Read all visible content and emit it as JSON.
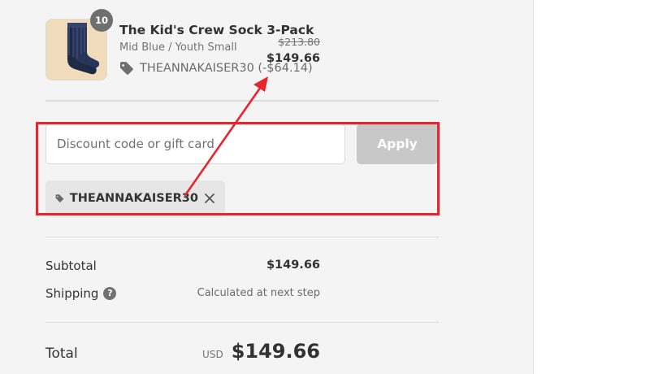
{
  "product": {
    "quantity_badge": "10",
    "name": "The Kid's Crew Sock 3-Pack",
    "variant": "Mid Blue / Youth Small",
    "discount_line": "THEANNAKAISER30 (-$64.14)",
    "original_price": "$213.80",
    "price": "$149.66",
    "image_icon": "sock-product-image"
  },
  "discount": {
    "placeholder": "Discount code or gift card",
    "value": "",
    "apply_label": "Apply",
    "applied_code": "THEANNAKAISER30",
    "tag_icon": "tag-icon",
    "remove_icon": "close-icon"
  },
  "summary": {
    "subtotal_label": "Subtotal",
    "subtotal_value": "$149.66",
    "shipping_label": "Shipping",
    "shipping_help_glyph": "?",
    "shipping_value": "Calculated at next step",
    "total_label": "Total",
    "currency": "USD",
    "total_value": "$149.66"
  },
  "annotation": {
    "color": "#e8242c",
    "shape": "highlight-box-with-arrow"
  }
}
